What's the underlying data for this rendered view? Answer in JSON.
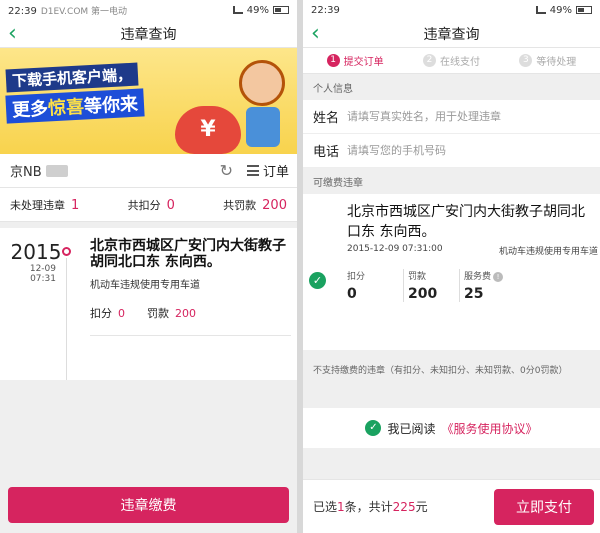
{
  "colors": {
    "accent": "#d6245f",
    "success": "#1aa260",
    "background": "#efefef"
  },
  "status_bar": {
    "time": "22:39",
    "battery": "49%",
    "watermark": "D1EV.COM 第一电动"
  },
  "left": {
    "title": "违章查询",
    "back_icon": "chevron-left-icon",
    "banner": {
      "line1": "下载手机客户端，",
      "line2_pre": "更多",
      "line2_hl": "惊喜",
      "line2_post": "等你来",
      "bag_symbol": "¥"
    },
    "plate": "京NB",
    "refresh_icon": "refresh-icon",
    "order_label": "订单",
    "stats": {
      "unprocessed_label": "未处理违章",
      "unprocessed": "1",
      "points_label": "共扣分",
      "points": "0",
      "fine_label": "共罚款",
      "fine": "200"
    },
    "violation": {
      "year": "2015",
      "date": "12-09",
      "time": "07:31",
      "address": "北京市西城区广安门内大街教子胡同北口东 东向西。",
      "type": "机动车违规使用专用车道",
      "points_label": "扣分",
      "points": "0",
      "fine_label": "罚款",
      "fine": "200"
    },
    "button": "违章缴费"
  },
  "right": {
    "title": "违章查询",
    "steps": [
      {
        "num": "1",
        "label": "提交订单"
      },
      {
        "num": "2",
        "label": "在线支付"
      },
      {
        "num": "3",
        "label": "等待处理"
      }
    ],
    "personal_section": "个人信息",
    "name_label": "姓名",
    "name_placeholder": "请填写真实姓名，用于处理违章",
    "phone_label": "电话",
    "phone_placeholder": "请填写您的手机号码",
    "payable_section": "可缴费违章",
    "payable": {
      "address": "北京市西城区广安门内大街教子胡同北口东 东向西。",
      "datetime": "2015-12-09 07:31:00",
      "type": "机动车违规使用专用车道",
      "points_label": "扣分",
      "points": "0",
      "fine_label": "罚款",
      "fine": "200",
      "service_label": "服务费",
      "service": "25"
    },
    "unsupported": "不支持缴费的违章（有扣分、未知扣分、未知罚款、0分0罚款）",
    "agree_pre": "我已阅读",
    "agree_link": "《服务使用协议》",
    "footer": {
      "pre": "已选",
      "count": "1",
      "mid": "条，共计",
      "total": "225",
      "post": "元"
    },
    "pay_button": "立即支付"
  }
}
